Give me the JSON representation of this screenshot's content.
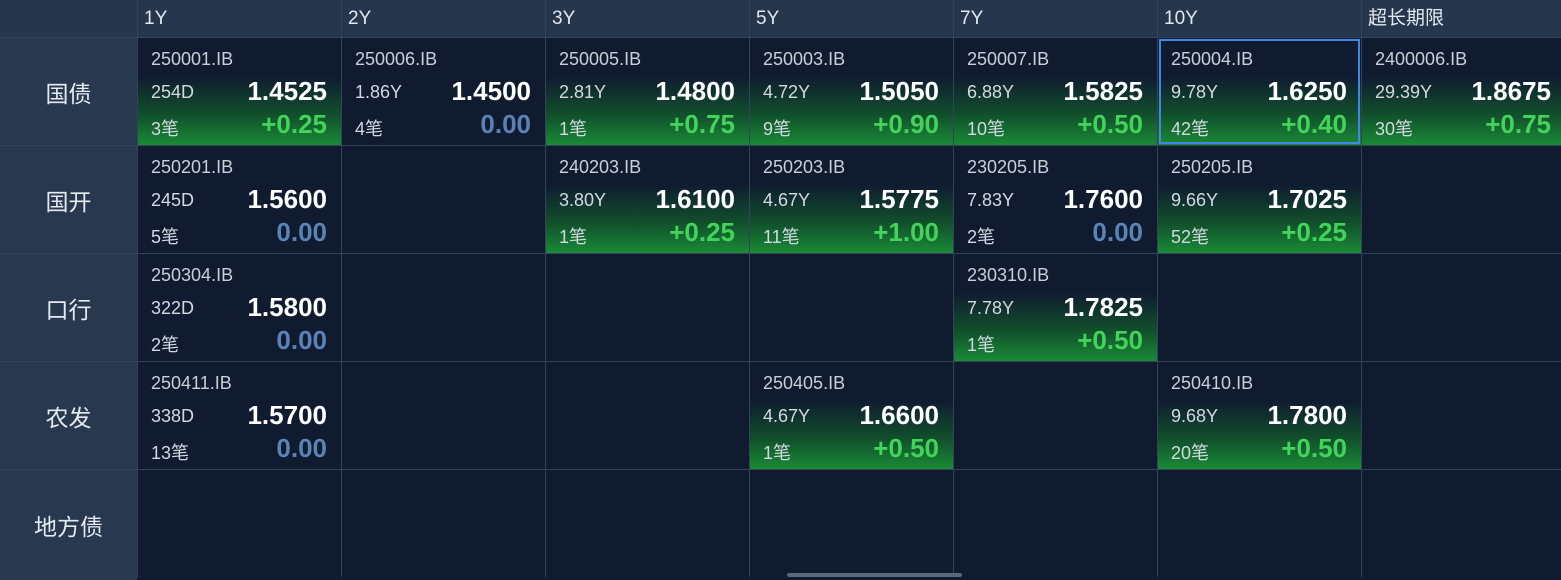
{
  "columns": [
    "1Y",
    "2Y",
    "3Y",
    "5Y",
    "7Y",
    "10Y",
    "超长期限"
  ],
  "rows": [
    {
      "label": "国债",
      "cells": [
        {
          "code": "250001.IB",
          "term": "254D",
          "yield": "1.4525",
          "count": "3笔",
          "change": "+0.25",
          "trend": "up"
        },
        {
          "code": "250006.IB",
          "term": "1.86Y",
          "yield": "1.4500",
          "count": "4笔",
          "change": "0.00",
          "trend": "flat"
        },
        {
          "code": "250005.IB",
          "term": "2.81Y",
          "yield": "1.4800",
          "count": "1笔",
          "change": "+0.75",
          "trend": "up"
        },
        {
          "code": "250003.IB",
          "term": "4.72Y",
          "yield": "1.5050",
          "count": "9笔",
          "change": "+0.90",
          "trend": "up"
        },
        {
          "code": "250007.IB",
          "term": "6.88Y",
          "yield": "1.5825",
          "count": "10笔",
          "change": "+0.50",
          "trend": "up"
        },
        {
          "code": "250004.IB",
          "term": "9.78Y",
          "yield": "1.6250",
          "count": "42笔",
          "change": "+0.40",
          "trend": "up",
          "selected": true
        },
        {
          "code": "2400006.IB",
          "term": "29.39Y",
          "yield": "1.8675",
          "count": "30笔",
          "change": "+0.75",
          "trend": "up"
        }
      ]
    },
    {
      "label": "国开",
      "cells": [
        {
          "code": "250201.IB",
          "term": "245D",
          "yield": "1.5600",
          "count": "5笔",
          "change": "0.00",
          "trend": "flat"
        },
        null,
        {
          "code": "240203.IB",
          "term": "3.80Y",
          "yield": "1.6100",
          "count": "1笔",
          "change": "+0.25",
          "trend": "up"
        },
        {
          "code": "250203.IB",
          "term": "4.67Y",
          "yield": "1.5775",
          "count": "11笔",
          "change": "+1.00",
          "trend": "up"
        },
        {
          "code": "230205.IB",
          "term": "7.83Y",
          "yield": "1.7600",
          "count": "2笔",
          "change": "0.00",
          "trend": "flat"
        },
        {
          "code": "250205.IB",
          "term": "9.66Y",
          "yield": "1.7025",
          "count": "52笔",
          "change": "+0.25",
          "trend": "up"
        },
        null
      ]
    },
    {
      "label": "口行",
      "cells": [
        {
          "code": "250304.IB",
          "term": "322D",
          "yield": "1.5800",
          "count": "2笔",
          "change": "0.00",
          "trend": "flat"
        },
        null,
        null,
        null,
        {
          "code": "230310.IB",
          "term": "7.78Y",
          "yield": "1.7825",
          "count": "1笔",
          "change": "+0.50",
          "trend": "up"
        },
        null,
        null
      ]
    },
    {
      "label": "农发",
      "cells": [
        {
          "code": "250411.IB",
          "term": "338D",
          "yield": "1.5700",
          "count": "13笔",
          "change": "0.00",
          "trend": "flat"
        },
        null,
        null,
        {
          "code": "250405.IB",
          "term": "4.67Y",
          "yield": "1.6600",
          "count": "1笔",
          "change": "+0.50",
          "trend": "up"
        },
        null,
        {
          "code": "250410.IB",
          "term": "9.68Y",
          "yield": "1.7800",
          "count": "20笔",
          "change": "+0.50",
          "trend": "up"
        },
        null
      ]
    },
    {
      "label": "地方债",
      "cells": [
        null,
        null,
        null,
        null,
        null,
        null,
        null
      ]
    }
  ],
  "colors": {
    "background": "#0f1a2e",
    "header_bg": "#26364d",
    "change_up": "#44d35a",
    "change_flat": "#5b82b6",
    "selection_border": "#3f86e6"
  }
}
